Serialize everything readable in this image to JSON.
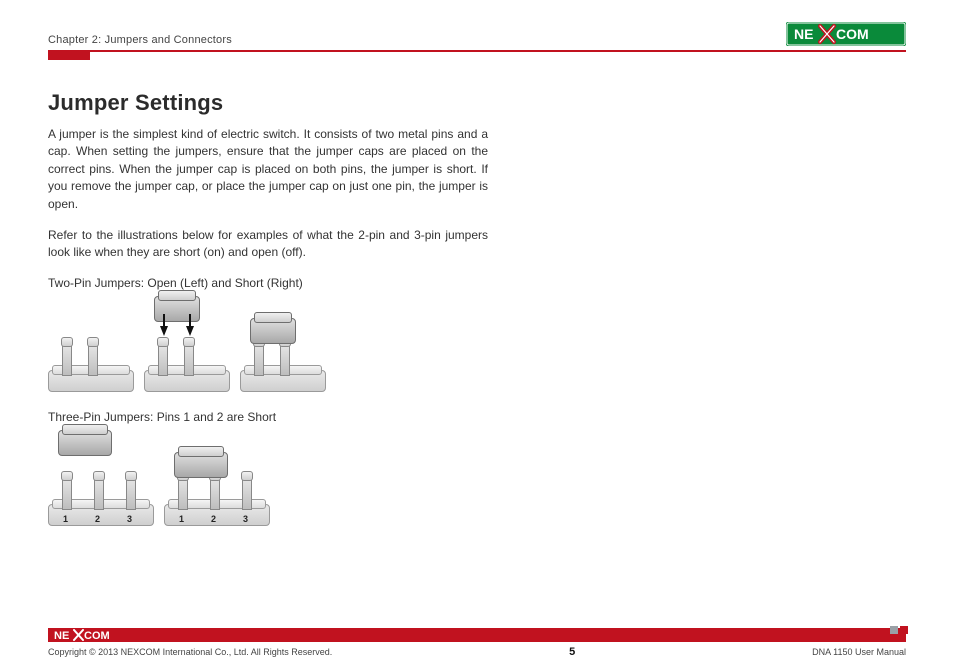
{
  "header": {
    "chapter": "Chapter 2: Jumpers and Connectors"
  },
  "brand": {
    "name": "NEXCOM",
    "logo_text_left": "NE",
    "logo_text_right": "COM"
  },
  "content": {
    "title": "Jumper Settings",
    "para1": "A jumper is the simplest kind of electric switch. It consists of two metal pins and a cap. When setting the jumpers, ensure that the jumper caps are placed on the correct pins. When the jumper cap is placed on both pins, the jumper is short. If you remove the jumper cap, or place the jumper cap on just one pin, the jumper is open.",
    "para2": "Refer to the illustrations below for examples of what the 2-pin and 3-pin jumpers look like when they are short (on) and open (off).",
    "caption1": "Two-Pin Jumpers: Open (Left) and Short (Right)",
    "caption2": "Three-Pin Jumpers: Pins 1 and 2 are Short",
    "pin_labels": {
      "p1": "1",
      "p2": "2",
      "p3": "3"
    }
  },
  "footer": {
    "copyright": "Copyright © 2013 NEXCOM International Co., Ltd. All Rights Reserved.",
    "page": "5",
    "manual": "DNA 1150 User Manual"
  }
}
